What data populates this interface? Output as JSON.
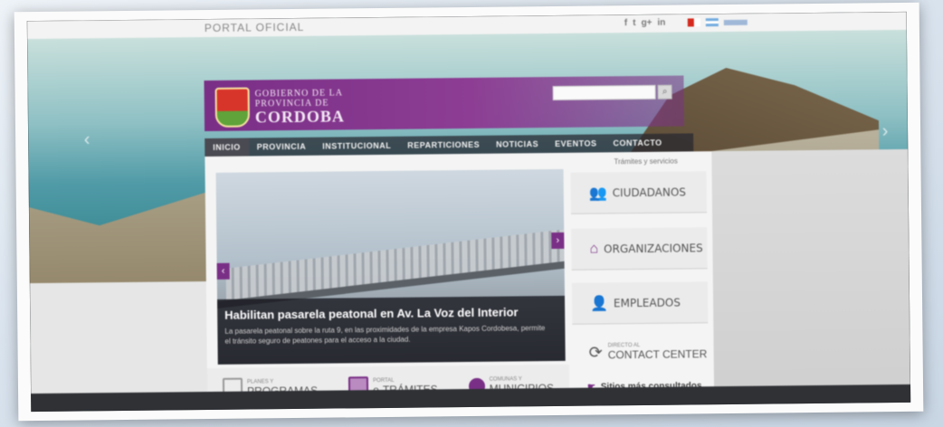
{
  "topbar": {
    "portal_title": "PORTAL OFICIAL",
    "social": [
      "f",
      "t",
      "g+",
      "in"
    ]
  },
  "header": {
    "logo_line1": "GOBIERNO DE LA",
    "logo_line2": "PROVINCIA DE",
    "logo_line3": "CORDOBA",
    "search_placeholder": ""
  },
  "nav": {
    "items": [
      "INICIO",
      "PROVINCIA",
      "INSTITUCIONAL",
      "REPARTICIONES",
      "NOTICIAS",
      "EVENTOS",
      "CONTACTO"
    ]
  },
  "main": {
    "tramites_link": "Trámites y servicios",
    "slider": {
      "headline": "Habilitan pasarela peatonal en Av. La Voz del Interior",
      "body": "La pasarela peatonal sobre la ruta 9, en las proximidades de la empresa Kapos Cordobesa, permite el tránsito seguro de peatones para el acceso a la ciudad."
    },
    "side_buttons": [
      {
        "icon": "people-icon",
        "label": "CIUDADANOS"
      },
      {
        "icon": "buildings-icon",
        "label": "ORGANIZACIONES"
      },
      {
        "icon": "employees-icon",
        "label": "EMPLEADOS"
      }
    ],
    "contact": {
      "small": "DIRECTO AL",
      "big": "CONTACT CENTER"
    },
    "bottom": [
      {
        "small": "PLANES Y",
        "big": "PROGRAMAS"
      },
      {
        "small": "PORTAL",
        "big": "e-TRÁMITES"
      },
      {
        "small": "COMUNAS Y",
        "big": "MUNICIPIOS"
      }
    ],
    "sitios": "Sitios más consultados"
  },
  "colors": {
    "brand_purple": "#7a2f86",
    "nav_dark": "#28282f"
  }
}
